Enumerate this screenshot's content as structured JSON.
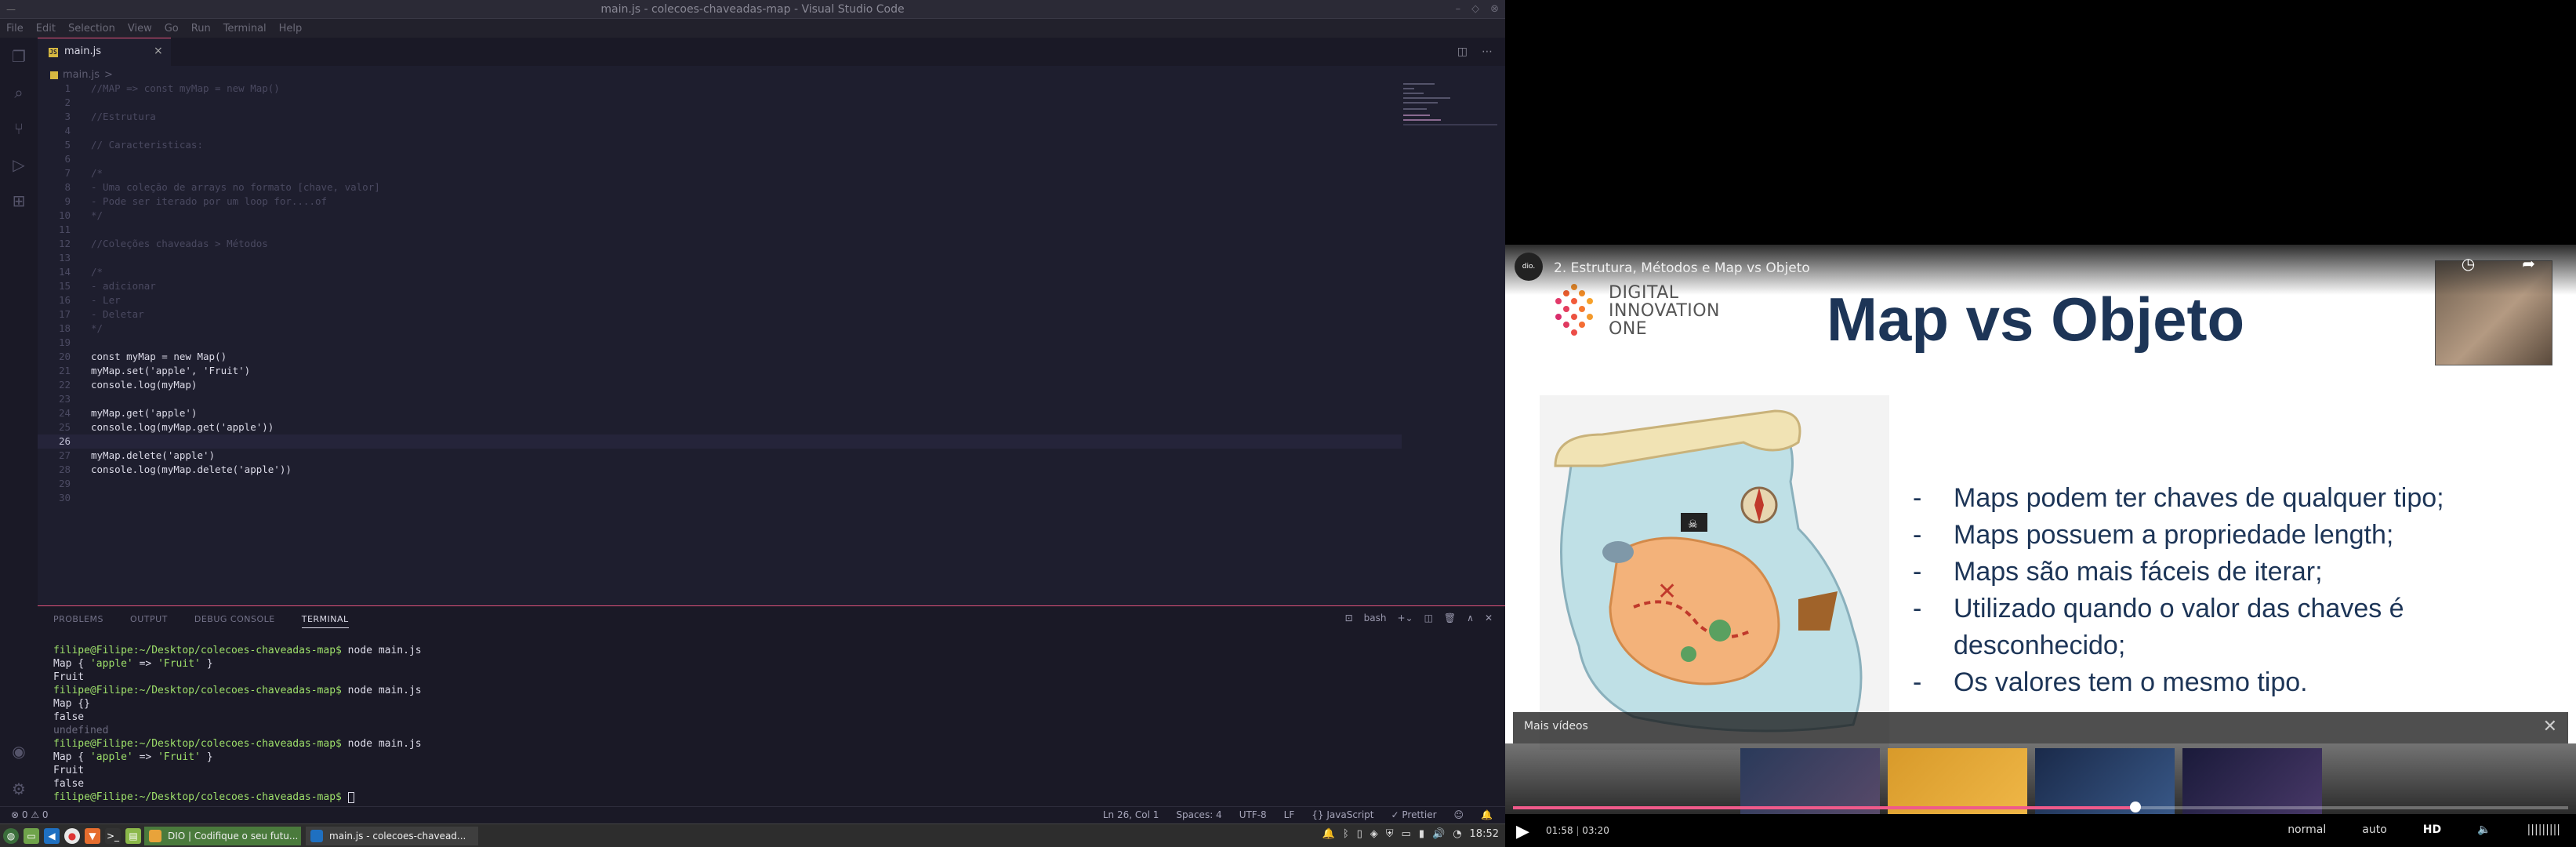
{
  "vscode": {
    "window_title": "main.js - colecoes-chaveadas-map - Visual Studio Code",
    "menu": [
      "File",
      "Edit",
      "Selection",
      "View",
      "Go",
      "Run",
      "Terminal",
      "Help"
    ],
    "tab": {
      "label": "main.js",
      "close": "×"
    },
    "breadcrumb": {
      "file": "main.js",
      "sep": ">"
    },
    "lines": [
      {
        "n": "1",
        "t": "//MAP => const myMap = new Map()"
      },
      {
        "n": "2",
        "t": ""
      },
      {
        "n": "3",
        "t": "//Estrutura"
      },
      {
        "n": "4",
        "t": ""
      },
      {
        "n": "5",
        "t": "// Caracteristicas:"
      },
      {
        "n": "6",
        "t": ""
      },
      {
        "n": "7",
        "t": "/*"
      },
      {
        "n": "8",
        "t": "- Uma coleção de arrays no formato [chave, valor]"
      },
      {
        "n": "9",
        "t": "- Pode ser iterado por um loop for....of"
      },
      {
        "n": "10",
        "t": "*/"
      },
      {
        "n": "11",
        "t": ""
      },
      {
        "n": "12",
        "t": "//Coleções chaveadas > Métodos"
      },
      {
        "n": "13",
        "t": ""
      },
      {
        "n": "14",
        "t": "/*"
      },
      {
        "n": "15",
        "t": "- adicionar"
      },
      {
        "n": "16",
        "t": "- Ler"
      },
      {
        "n": "17",
        "t": "- Deletar"
      },
      {
        "n": "18",
        "t": "*/"
      },
      {
        "n": "19",
        "t": ""
      },
      {
        "n": "20",
        "t": "const myMap = new Map()"
      },
      {
        "n": "21",
        "t": "myMap.set('apple', 'Fruit')"
      },
      {
        "n": "22",
        "t": "console.log(myMap)"
      },
      {
        "n": "23",
        "t": ""
      },
      {
        "n": "24",
        "t": "myMap.get('apple')"
      },
      {
        "n": "25",
        "t": "console.log(myMap.get('apple'))"
      },
      {
        "n": "26",
        "t": ""
      },
      {
        "n": "27",
        "t": "myMap.delete('apple')"
      },
      {
        "n": "28",
        "t": "console.log(myMap.delete('apple'))"
      },
      {
        "n": "29",
        "t": ""
      },
      {
        "n": "30",
        "t": ""
      }
    ],
    "panel_tabs": [
      "PROBLEMS",
      "OUTPUT",
      "DEBUG CONSOLE",
      "TERMINAL"
    ],
    "panel_shell": "bash",
    "terminal": {
      "prompt": "filipe@Filipe:~/Desktop/colecoes-chaveadas-map$",
      "cmd": " node main.js",
      "map_open": "Map { ",
      "apple": "'apple'",
      "arrow": " => ",
      "fruit": "'Fruit'",
      "map_close": " }",
      "out_fruit": "Fruit",
      "map_empty": "Map {}",
      "out_false": "false",
      "out_undefined": "undefined"
    },
    "status": {
      "errors": "⊗ 0  ⚠ 0",
      "position": "Ln 26, Col 1",
      "spaces": "Spaces: 4",
      "encoding": "UTF-8",
      "eol": "LF",
      "language": "{} JavaScript",
      "formatter": "✓ Prettier"
    }
  },
  "taskbar": {
    "windows": [
      "DIO | Codifique o seu futu...",
      "main.js - colecoes-chavead..."
    ],
    "clock": "18:52"
  },
  "player": {
    "video_title": "2. Estrutura, Métodos e Map vs Objeto",
    "channel": "dio.",
    "slide": {
      "logo_lines": [
        "DIGITAL",
        "INNOVATION",
        "ONE"
      ],
      "title": "Map vs Objeto",
      "bullets": [
        "Maps podem ter chaves de qualquer tipo;",
        "Maps possuem a propriedade length;",
        "Maps são mais fáceis de iterar;",
        "Utilizado quando o valor das chaves é desconhecido;",
        "Os valores tem o mesmo tipo."
      ]
    },
    "more_videos": "Mais vídeos",
    "current_time": "01:58",
    "duration": "03:20",
    "progress": 0.59,
    "speed": "normal",
    "quality_mode": "auto",
    "quality": "HD",
    "colors": {
      "accent": "#f05a8a",
      "slide_title": "#1d3557"
    }
  }
}
